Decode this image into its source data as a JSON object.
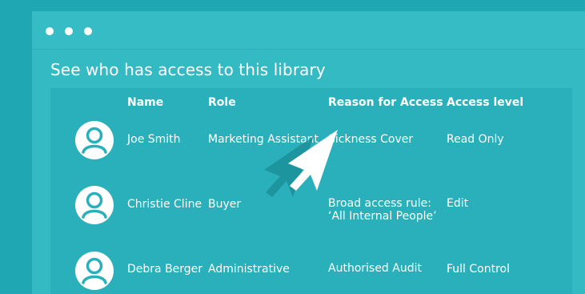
{
  "window": {
    "title_dots": [
      "dot-1",
      "dot-2",
      "dot-3"
    ]
  },
  "heading": "See who has access to this library",
  "table": {
    "columns": [
      "Name",
      "Role",
      "Reason for Access",
      "Access level"
    ],
    "rows": [
      {
        "name": "Joe Smith",
        "role": "Marketing Assistant",
        "reason_line1": "Sickness Cover",
        "reason_line2": "",
        "access": "Read Only"
      },
      {
        "name": "Christie Cline",
        "role": "Buyer",
        "reason_line1": "Broad access rule:",
        "reason_line2": "‘All Internal People’",
        "access": "Edit"
      },
      {
        "name": "Debra Berger",
        "role": "Administrative",
        "reason_line1": "Authorised Audit",
        "reason_line2": "",
        "access": "Full Control"
      }
    ]
  },
  "colors": {
    "background": "#1fa8b3",
    "window": "#34bac3",
    "panel": "#2ab0ba",
    "text": "#ffffff",
    "cursor_shadow": "#1a8c96"
  },
  "icons": {
    "avatar": "user-avatar-icon",
    "cursor": "pointer-cursor-icon"
  }
}
